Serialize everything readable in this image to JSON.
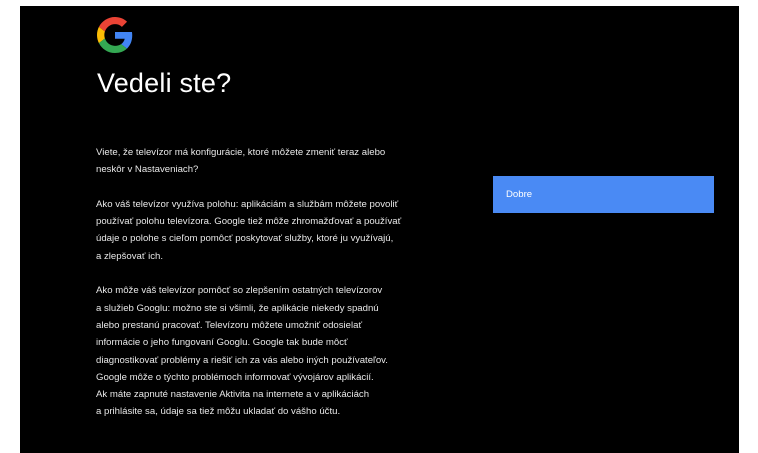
{
  "logo": {
    "icon": "google-g-icon",
    "colors": {
      "blue": "#4285F4",
      "red": "#EA4335",
      "yellow": "#FBBC05",
      "green": "#34A853"
    }
  },
  "page": {
    "title": "Vedeli ste?"
  },
  "paragraphs": [
    {
      "lines": [
        "Viete, že televízor má konfigurácie, ktoré môžete zmeniť teraz alebo",
        "neskôr v Nastaveniach?"
      ]
    },
    {
      "lines": [
        "Ako váš televízor využíva polohu: aplikáciám a službám môžete povoliť",
        "používať polohu televízora. Google tiež môže zhromažďovať a používať",
        "údaje o polohe s cieľom pomôcť poskytovať služby, ktoré ju využívajú,",
        "a zlepšovať ich."
      ]
    },
    {
      "lines": [
        "Ako môže váš televízor pomôcť so zlepšením ostatných televízorov",
        "a služieb Googlu: možno ste si všimli, že aplikácie niekedy spadnú",
        "alebo prestanú pracovať. Televízoru môžete umožniť odosielať",
        "informácie o jeho fungovaní Googlu. Google tak bude môcť",
        "diagnostikovať problémy a riešiť ich za vás alebo iných používateľov.",
        "Google môže o týchto problémoch informovať vývojárov aplikácií.",
        "Ak máte zapnuté nastavenie Aktivita na internete a v aplikáciách",
        "a prihlásite sa, údaje sa tiež môžu ukladať do vášho účtu."
      ]
    }
  ],
  "actions": {
    "ok_label": "Dobre",
    "accent": "#4A8AF4"
  }
}
